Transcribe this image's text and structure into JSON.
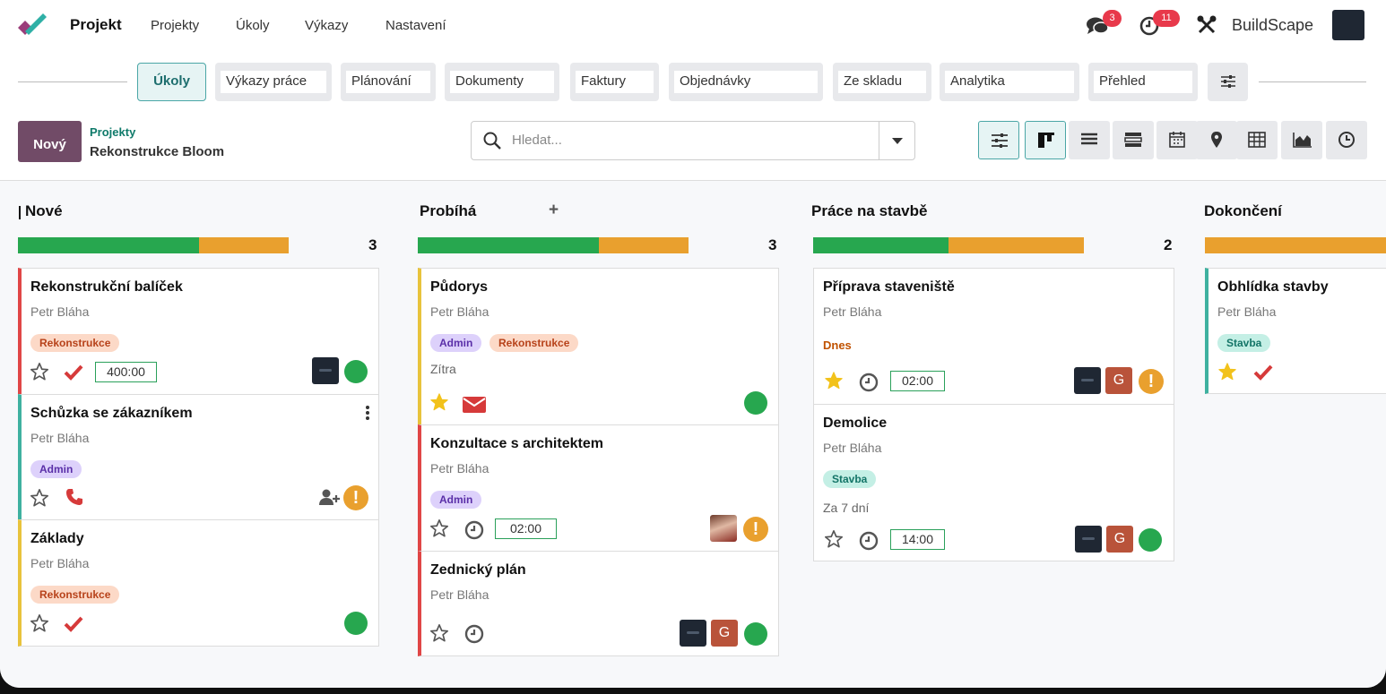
{
  "app": {
    "title": "Projekt",
    "menu": [
      "Projekty",
      "Úkoly",
      "Výkazy",
      "Nastavení"
    ],
    "messages_count": "3",
    "activities_count": "11",
    "company": "BuildScape"
  },
  "tabs": [
    "Úkoly",
    "Výkazy práce",
    "Plánování",
    "Dokumenty",
    "Faktury",
    "Objednávky",
    "Ze skladu",
    "Analytika",
    "Přehled"
  ],
  "control": {
    "new_label": "Nový",
    "breadcrumb_parent": "Projekty",
    "breadcrumb_current": "Rekonstrukce Bloom",
    "search_placeholder": "Hledat...",
    "views": [
      "filters",
      "kanban",
      "list",
      "gantt",
      "calendar",
      "map",
      "pivot",
      "graph",
      "activity"
    ],
    "active_view": "kanban"
  },
  "colors": {
    "accent": "#714b67",
    "teal": "#1d6e6e",
    "done": "#27a74f",
    "blocked": "#e9a02e"
  },
  "columns": [
    {
      "title": "Nové",
      "count": "3",
      "progress_green": 0.67,
      "progress_orange": 0.33,
      "cards": [
        {
          "title": "Rekonstrukční balíček",
          "person": "Petr Bláha",
          "tags": [
            "Rekonstrukce"
          ],
          "hours": "400:00",
          "icon": "check-icon",
          "status": "green",
          "color": "red"
        },
        {
          "title": "Schůzka se zákazníkem",
          "person": "Petr Bláha",
          "tags": [
            "Admin"
          ],
          "icon": "phone-icon",
          "status": "warning",
          "color": "teal"
        },
        {
          "title": "Základy",
          "person": "Petr Bláha",
          "tags": [
            "Rekonstrukce"
          ],
          "icon": "check-icon",
          "status": "green",
          "color": "yellow"
        }
      ]
    },
    {
      "title": "Probíhá",
      "count": "3",
      "progress_green": 0.67,
      "progress_orange": 0.33,
      "cards": [
        {
          "title": "Půdorys",
          "person": "Petr Bláha",
          "tags": [
            "Admin",
            "Rekonstrukce"
          ],
          "deadline": "Zítra",
          "starred": true,
          "icon": "email-icon",
          "status": "green",
          "color": "yellow"
        },
        {
          "title": "Konzultace s architektem",
          "person": "Petr Bláha",
          "tags": [
            "Admin"
          ],
          "hours": "02:00",
          "icon": "clock-icon",
          "status": "warning",
          "color": "red"
        },
        {
          "title": "Zednický plán",
          "person": "Petr Bláha",
          "tags": [],
          "icon": "clock-icon",
          "status": "green",
          "color": "red"
        }
      ]
    },
    {
      "title": "Práce na stavbě",
      "count": "2",
      "progress_green": 0.5,
      "progress_orange": 0.5,
      "cards": [
        {
          "title": "Příprava staveniště",
          "person": "Petr Bláha",
          "tags": [],
          "deadline": "Dnes",
          "starred": true,
          "hours": "02:00",
          "icon": "clock-icon",
          "status": "warning",
          "color": "none"
        },
        {
          "title": "Demolice",
          "person": "Petr Bláha",
          "tags": [
            "Stavba"
          ],
          "deadline": "Za 7 dní",
          "hours": "14:00",
          "icon": "clock-icon",
          "status": "green",
          "color": "none"
        }
      ]
    },
    {
      "title": "Dokončení",
      "count": "",
      "progress_green": 0,
      "progress_orange": 1,
      "cards": [
        {
          "title": "Obhlídka stavby",
          "person": "Petr Bláha",
          "tags": [
            "Stavba"
          ],
          "starred": true,
          "icon": "check-icon",
          "color": "teal"
        }
      ]
    }
  ]
}
